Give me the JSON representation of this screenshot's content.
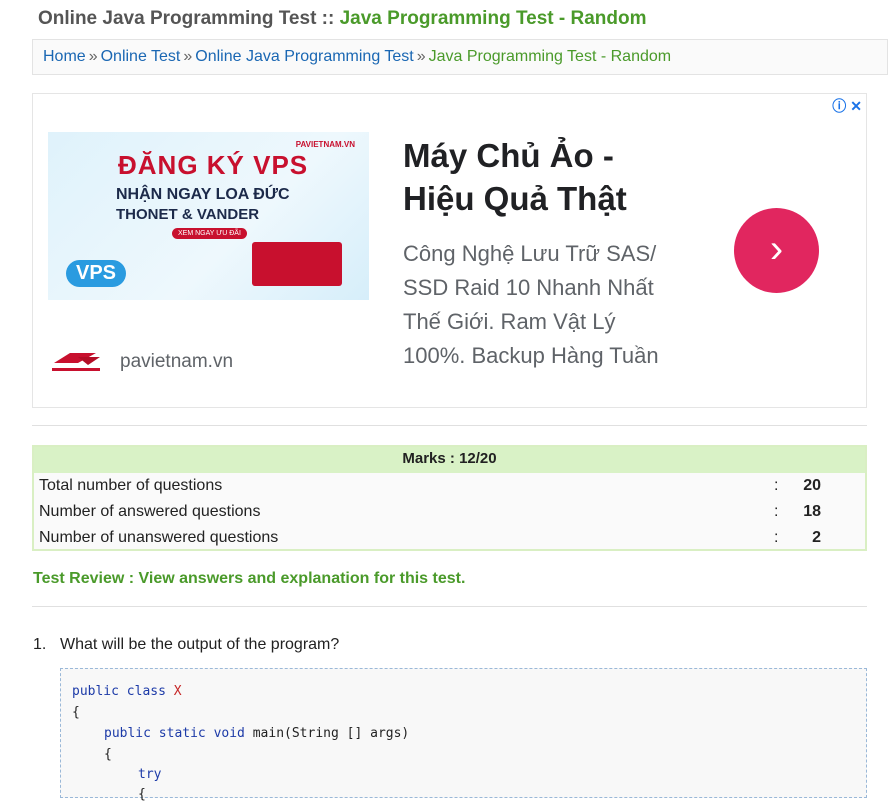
{
  "header": {
    "title_prefix": "Online Java Programming Test :: ",
    "title_highlight": "Java Programming Test - Random"
  },
  "breadcrumb": {
    "items": [
      "Home",
      "Online Test",
      "Online Java Programming Test"
    ],
    "separator": "»",
    "current": "Java Programming Test - Random"
  },
  "ad": {
    "image_line1": "ĐĂNG KÝ VPS",
    "image_line2": "NHẬN NGAY LOA ĐỨC",
    "image_line3": "THONET & VANDER",
    "image_button": "XEM NGAY ƯU ĐÃI",
    "image_badge": "VPS",
    "image_logo": "PAVIETNAM.VN",
    "headline": "Máy Chủ Ảo - Hiệu Quả Thật",
    "body": "Công Nghệ Lưu Trữ SAS/ SSD Raid 10 Nhanh Nhất Thế Giới. Ram Vật Lý 100%. Backup Hàng Tuần",
    "brand": "pavietnam.vn",
    "info_icon": "info-icon",
    "close_icon": "close-icon",
    "arrow_icon": "chevron-right-icon",
    "arrow_glyph": "›",
    "accent_color": "#e1265f"
  },
  "marks": {
    "heading": "Marks : 12/20",
    "rows": [
      {
        "label": "Total number of questions",
        "value": "20"
      },
      {
        "label": "Number of answered questions",
        "value": "18"
      },
      {
        "label": "Number of unanswered questions",
        "value": "2"
      }
    ]
  },
  "review_link": "Test Review : View answers and explanation for this test.",
  "question": {
    "number": "1.",
    "text": "What will be the output of the program?",
    "code": {
      "l1_kw": "public class",
      "l1_cls": "X",
      "l2": "{",
      "l3_kw": "public static void",
      "l3_rest": "main(String [] args)",
      "l4": "{",
      "l5_kw": "try",
      "l6": "{"
    }
  },
  "colors": {
    "green": "#4a9a2a",
    "link_blue": "#1a67b3",
    "marks_header": "#d9f2c6"
  }
}
